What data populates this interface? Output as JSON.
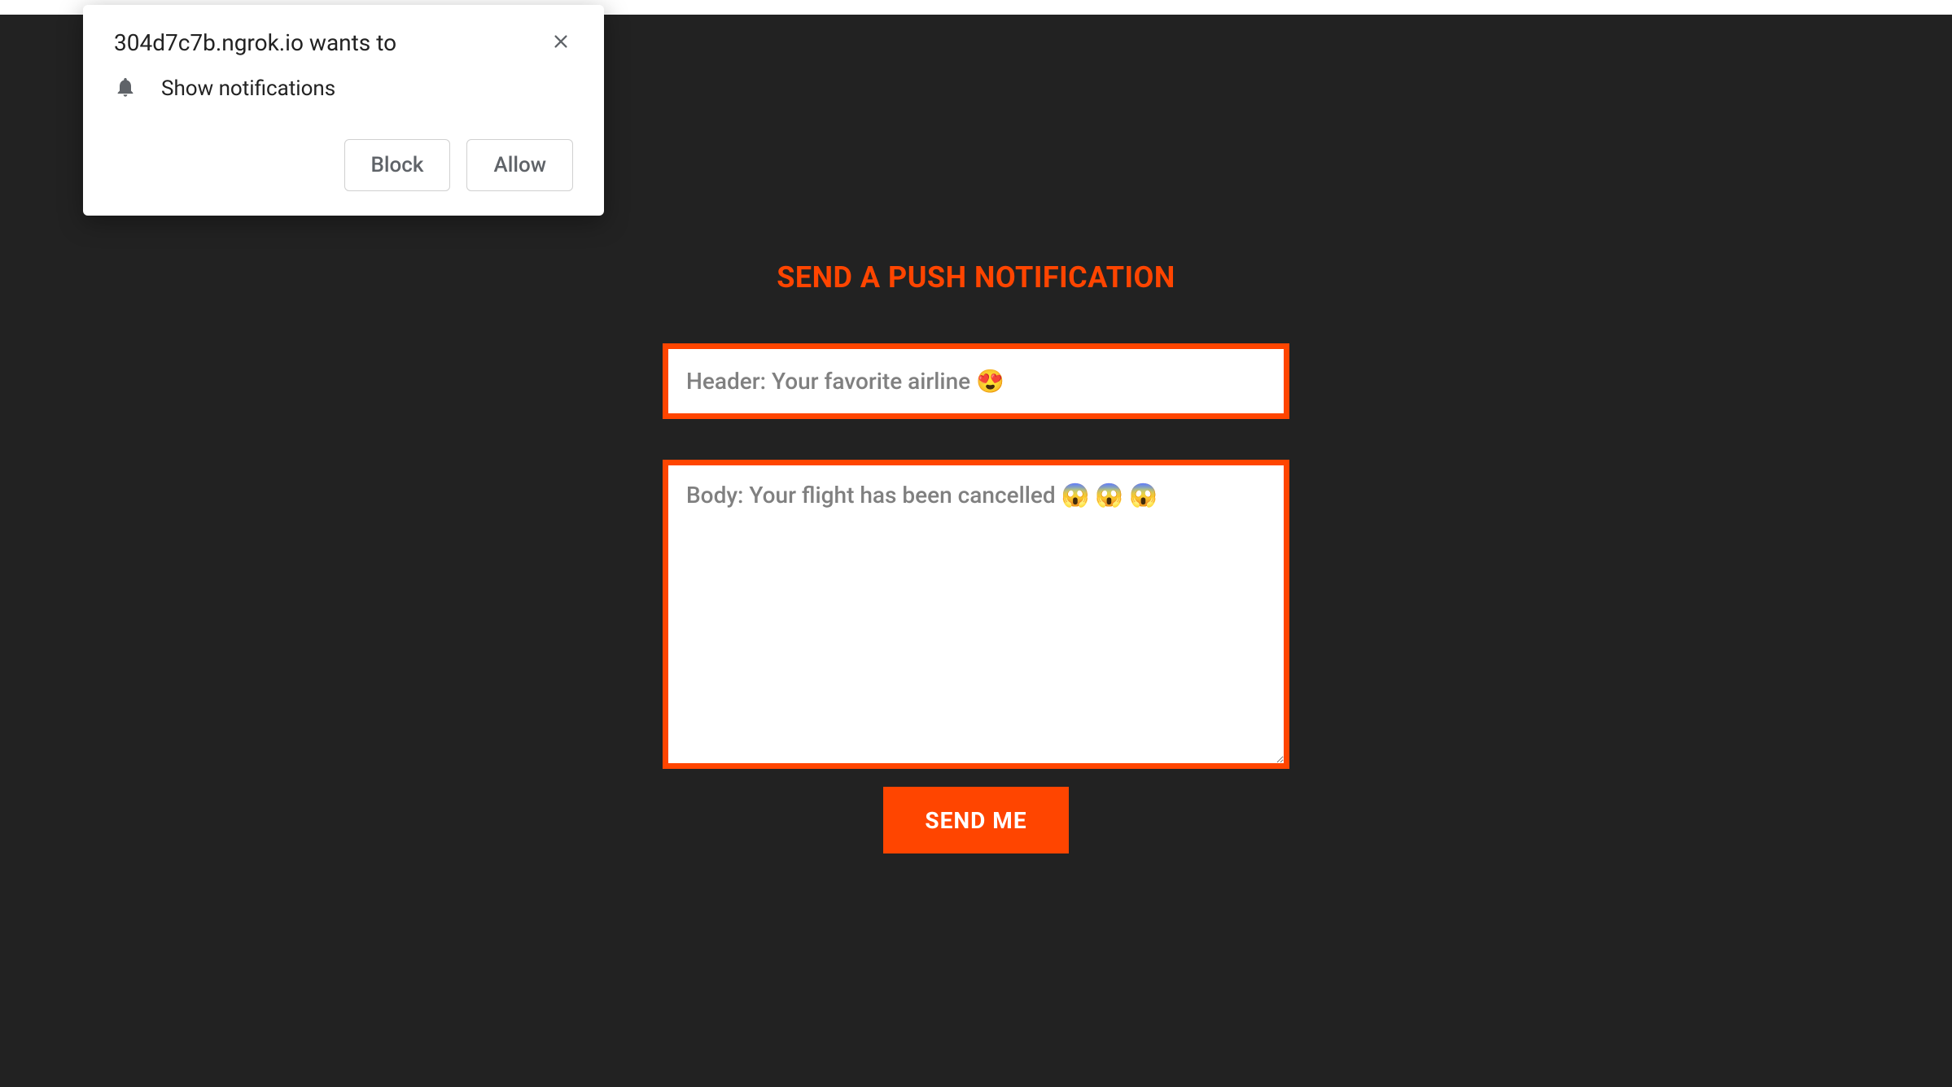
{
  "page": {
    "title": "SEND A PUSH NOTIFICATION"
  },
  "form": {
    "header_placeholder": "Header: Your favorite airline 😍",
    "body_placeholder": "Body: Your flight has been cancelled 😱 😱 😱",
    "send_label": "SEND ME"
  },
  "dialog": {
    "origin": "304d7c7b.ngrok.io wants to",
    "message": "Show notifications",
    "block_label": "Block",
    "allow_label": "Allow"
  }
}
